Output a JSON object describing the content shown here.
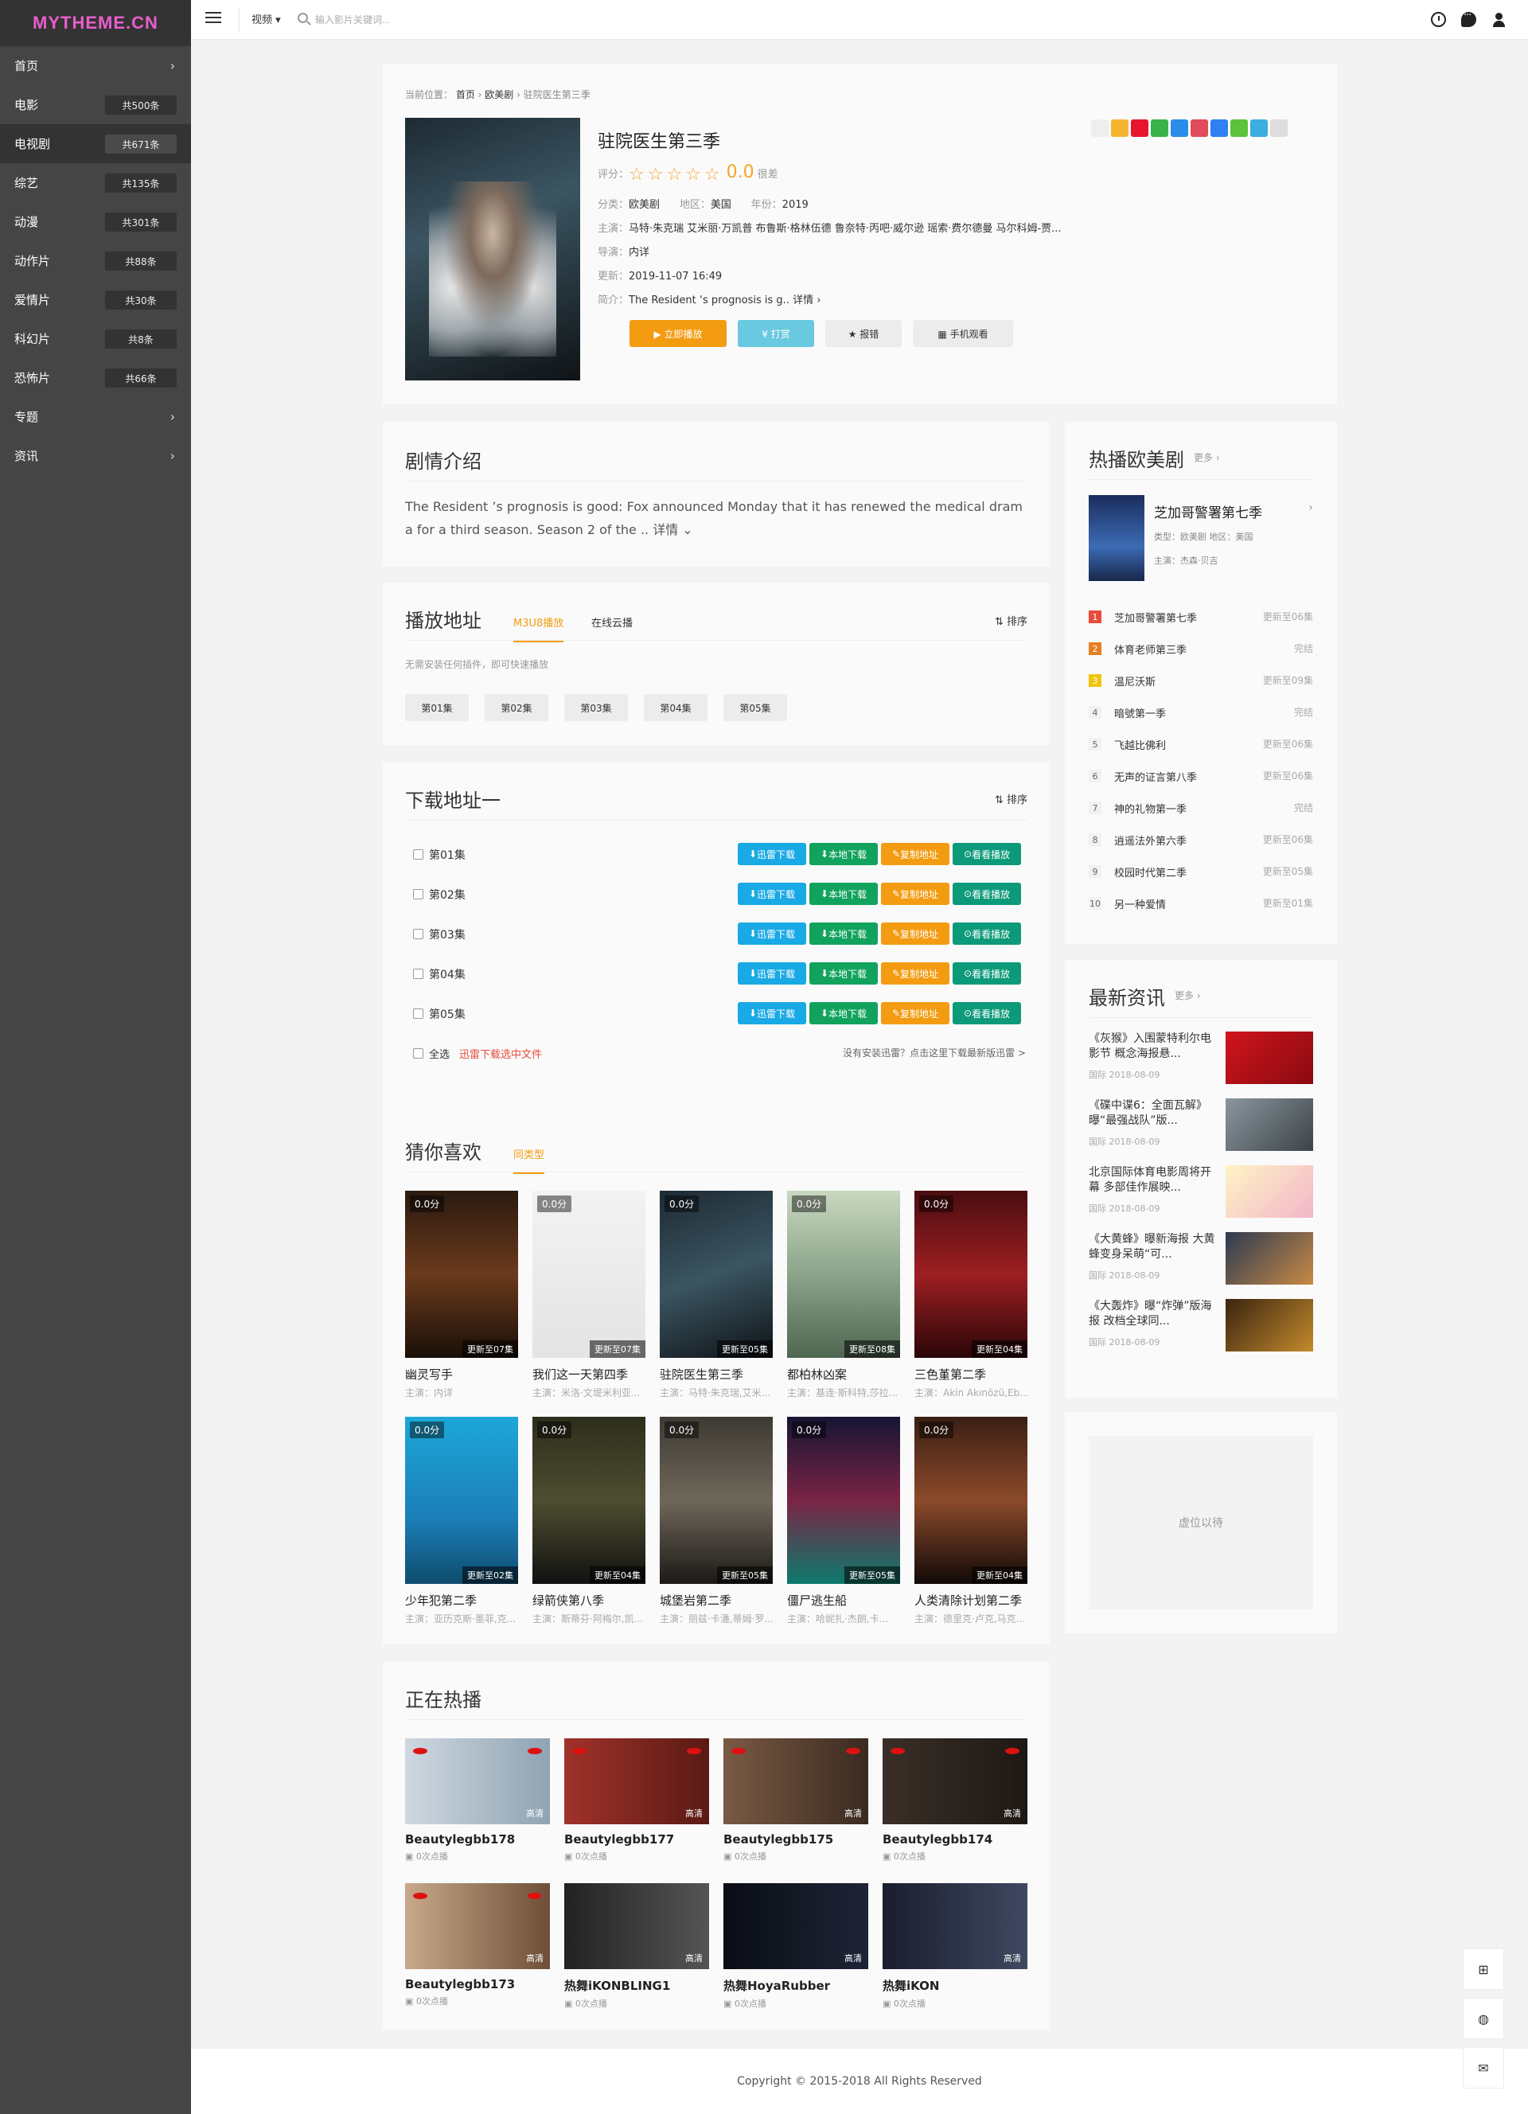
{
  "logo": "MYTHEME.CN",
  "sidebar": {
    "items": [
      {
        "label": "首页",
        "count": "",
        "chev": "›"
      },
      {
        "label": "电影",
        "count": "共500条",
        "chev": ""
      },
      {
        "label": "电视剧",
        "count": "共671条",
        "chev": ""
      },
      {
        "label": "综艺",
        "count": "共135条",
        "chev": ""
      },
      {
        "label": "动漫",
        "count": "共301条",
        "chev": ""
      },
      {
        "label": "动作片",
        "count": "共88条",
        "chev": ""
      },
      {
        "label": "爱情片",
        "count": "共30条",
        "chev": ""
      },
      {
        "label": "科幻片",
        "count": "共8条",
        "chev": ""
      },
      {
        "label": "恐怖片",
        "count": "共66条",
        "chev": ""
      },
      {
        "label": "专题",
        "count": "",
        "chev": "›"
      },
      {
        "label": "资讯",
        "count": "",
        "chev": "›"
      }
    ]
  },
  "topbar": {
    "category": "视频 ▾",
    "search_placeholder": "输入影片关键词..."
  },
  "detail": {
    "breadcrumb_prefix": "当前位置：",
    "crumb1": "首页",
    "crumb2": "欧美剧",
    "crumb3": "驻院医生第三季",
    "title": "驻院医生第三季",
    "rating_label": "评分：",
    "stars": "☆☆☆☆☆",
    "score": "0.0",
    "score_suffix": "很差",
    "category_label": "分类：",
    "category": "欧美剧",
    "area_label": "地区：",
    "area": "美国",
    "year_label": "年份：",
    "year": "2019",
    "cast_label": "主演：",
    "cast": "马特·朱克瑞   艾米丽·万凯普   布鲁斯·格林伍德   鲁奈特·丙吧·威尔逊   瑶索·费尔德曼   马尔科姆-贾...",
    "director_label": "导演：",
    "director": "内详",
    "updated_label": "更新：",
    "updated": "2019-11-07 16:49",
    "summary_label": "简介：",
    "summary": "The Resident ‘s prognosis is g.. 详情 ›",
    "btn_play": "▶ 立即播放",
    "btn_tip": "¥ 打赏",
    "btn_report": "★ 报错",
    "btn_mobile": "▦ 手机观看"
  },
  "intro": {
    "title": "剧情介绍",
    "text": "The Resident  ’s prognosis is good: Fox announced Monday that it has renewed the medical drama for a third season. Season 2 of the .. 详情 ⌄"
  },
  "play": {
    "title": "播放地址",
    "tab1": "M3U8播放",
    "tab2": "在线云播",
    "sort": "排序",
    "hint": "无需安装任何插件，即可快速播放",
    "episodes": [
      "第01集",
      "第02集",
      "第03集",
      "第04集",
      "第05集"
    ]
  },
  "download": {
    "title": "下载地址一",
    "sort": "排序",
    "rows": [
      "第01集",
      "第02集",
      "第03集",
      "第04集",
      "第05集"
    ],
    "b1": "迅雷下载",
    "b2": "本地下载",
    "b3": "复制地址",
    "b4": "看看播放",
    "select_all": "全选",
    "thunder_selected": "迅雷下载选中文件",
    "notice": "没有安装迅雷？点击这里下载最新版迅雷 >"
  },
  "guess": {
    "title": "猜你喜欢",
    "tab": "同类型",
    "items": [
      {
        "title": "幽灵写手",
        "sub": "主演：内详",
        "score": "0.0分",
        "upd": "更新至07集"
      },
      {
        "title": "我们这一天第四季",
        "sub": "主演：米洛·文堤米利亚...",
        "score": "0.0分",
        "upd": "更新至07集"
      },
      {
        "title": "驻院医生第三季",
        "sub": "主演：马特·朱克瑞,艾米...",
        "score": "0.0分",
        "upd": "更新至05集"
      },
      {
        "title": "都柏林凶案",
        "sub": "主演：基连·斯科特,莎拉...",
        "score": "0.0分",
        "upd": "更新至08集"
      },
      {
        "title": "三色堇第二季",
        "sub": "主演：Akin Akınözü,Eb...",
        "score": "0.0分",
        "upd": "更新至04集"
      },
      {
        "title": "少年犯第二季",
        "sub": "主演：亚历克斯·墨菲,克...",
        "score": "0.0分",
        "upd": "更新至02集"
      },
      {
        "title": "绿箭侠第八季",
        "sub": "主演：斯蒂芬·阿梅尔,凯...",
        "score": "0.0分",
        "upd": "更新至04集"
      },
      {
        "title": "城堡岩第二季",
        "sub": "主演：丽兹·卡潘,蒂姆·罗...",
        "score": "0.0分",
        "upd": "更新至05集"
      },
      {
        "title": "僵尸逃生船",
        "sub": "主演：哈妮扎·杰朗,卡...",
        "score": "0.0分",
        "upd": "更新至05集"
      },
      {
        "title": "人类清除计划第二季",
        "sub": "主演：德里克·卢克,马克...",
        "score": "0.0分",
        "upd": "更新至04集"
      }
    ]
  },
  "hotnow": {
    "title": "正在热播",
    "items": [
      {
        "title": "Beautylegbb178",
        "views": "0次点播",
        "hd": "高清"
      },
      {
        "title": "Beautylegbb177",
        "views": "0次点播",
        "hd": "高清"
      },
      {
        "title": "Beautylegbb175",
        "views": "0次点播",
        "hd": "高清"
      },
      {
        "title": "Beautylegbb174",
        "views": "0次点播",
        "hd": "高清"
      },
      {
        "title": "Beautylegbb173",
        "views": "0次点播",
        "hd": "高清"
      },
      {
        "title": "热舞iKONBLING1",
        "views": "0次点播",
        "hd": "高清"
      },
      {
        "title": "热舞HoyaRubber",
        "views": "0次点播",
        "hd": "高清"
      },
      {
        "title": "热舞iKON",
        "views": "0次点播",
        "hd": "高清"
      }
    ]
  },
  "rank": {
    "title": "热播欧美剧",
    "more": "更多 ›",
    "top": {
      "title": "芝加哥警署第七季",
      "type": "类型：欧美剧   地区：美国",
      "cast": "主演：杰森·贝吉"
    },
    "items": [
      {
        "num": "1",
        "name": "芝加哥警署第七季",
        "status": "更新至06集",
        "color": "#e74c3c"
      },
      {
        "num": "2",
        "name": "体育老师第三季",
        "status": "完结",
        "color": "#e67e22"
      },
      {
        "num": "3",
        "name": "温尼沃斯",
        "status": "更新至09集",
        "color": "#f1c40f"
      },
      {
        "num": "4",
        "name": "暗號第一季",
        "status": "完结",
        "color": ""
      },
      {
        "num": "5",
        "name": "飞越比佛利",
        "status": "更新至06集",
        "color": ""
      },
      {
        "num": "6",
        "name": "无声的证言第八季",
        "status": "更新至06集",
        "color": ""
      },
      {
        "num": "7",
        "name": "神的礼物第一季",
        "status": "完结",
        "color": ""
      },
      {
        "num": "8",
        "name": "逍遥法外第六季",
        "status": "更新至06集",
        "color": ""
      },
      {
        "num": "9",
        "name": "校园时代第二季",
        "status": "更新至05集",
        "color": ""
      },
      {
        "num": "10",
        "name": "另一种爱情",
        "status": "更新至01集",
        "color": ""
      }
    ]
  },
  "news": {
    "title": "最新资讯",
    "more": "更多 ›",
    "items": [
      {
        "title": "《灰猴》入围蒙特利尔电影节 概念海报悬...",
        "meta": "国际      2018-08-09"
      },
      {
        "title": "《碟中谍6：全面瓦解》曝“最强战队”版...",
        "meta": "国际      2018-08-09"
      },
      {
        "title": "北京国际体育电影周将开幕 多部佳作展映...",
        "meta": "国际      2018-08-09"
      },
      {
        "title": "《大黄蜂》曝新海报 大黄蜂变身呆萌“可...",
        "meta": "国际      2018-08-09"
      },
      {
        "title": "《大轰炸》曝“炸弹”版海报 改档全球同...",
        "meta": "国际      2018-08-09"
      }
    ]
  },
  "ad": {
    "text": "虚位以待"
  },
  "footer": {
    "copyright": "Copyright © 2015-2018 All Rights Reserved"
  },
  "colors": {
    "orange": "#f39c12",
    "blue": "#19a9e5",
    "green": "#11a35e",
    "teal": "#0d9a7a",
    "logo": "#e95ecc"
  }
}
